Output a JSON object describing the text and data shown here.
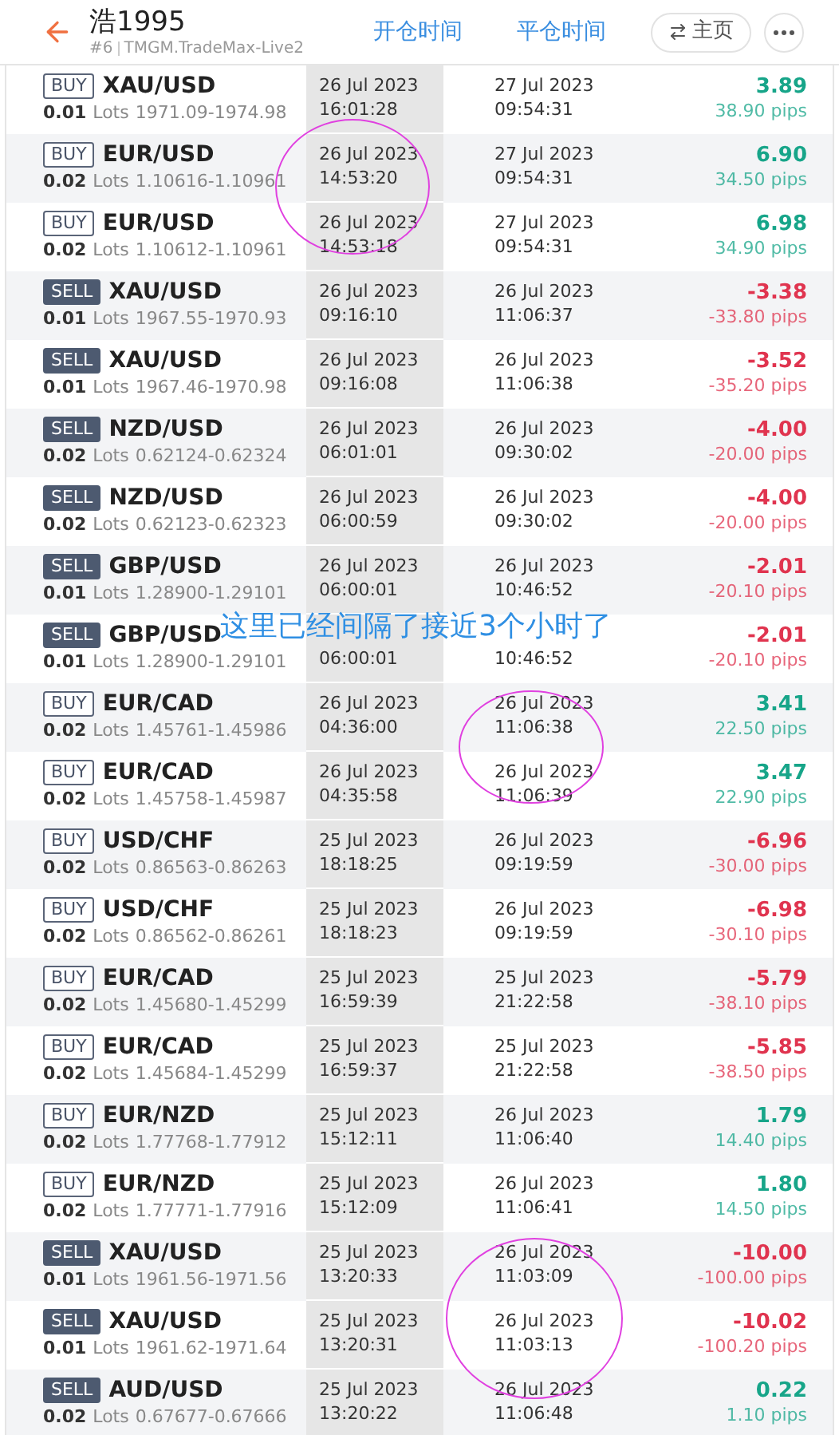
{
  "header": {
    "title": "浩1995",
    "account_number": "#6",
    "server": "TMGM.TradeMax-Live2",
    "column_headers": [
      "开仓时间",
      "平仓时间"
    ],
    "home_button": "主页"
  },
  "trades": [
    {
      "kind": "buy",
      "side": "BUY",
      "pair": "XAU/USD",
      "lots": "0.01",
      "lots_label": "Lots",
      "range": "1971.09-1974.98",
      "open_date": "26 Jul 2023",
      "open_time": "16:01:28",
      "close_date": "27 Jul 2023",
      "close_time": "09:54:31",
      "color": "#17a589",
      "profit": "3.89",
      "pips": "38.90 pips"
    },
    {
      "kind": "buy",
      "side": "BUY",
      "pair": "EUR/USD",
      "lots": "0.02",
      "lots_label": "Lots",
      "range": "1.10616-1.10961",
      "open_date": "26 Jul 2023",
      "open_time": "14:53:20",
      "close_date": "27 Jul 2023",
      "close_time": "09:54:31",
      "color": "#17a589",
      "profit": "6.90",
      "pips": "34.50 pips"
    },
    {
      "kind": "buy",
      "side": "BUY",
      "pair": "EUR/USD",
      "lots": "0.02",
      "lots_label": "Lots",
      "range": "1.10612-1.10961",
      "open_date": "26 Jul 2023",
      "open_time": "14:53:18",
      "close_date": "27 Jul 2023",
      "close_time": "09:54:31",
      "color": "#17a589",
      "profit": "6.98",
      "pips": "34.90 pips"
    },
    {
      "kind": "sell",
      "side": "SELL",
      "pair": "XAU/USD",
      "lots": "0.01",
      "lots_label": "Lots",
      "range": "1967.55-1970.93",
      "open_date": "26 Jul 2023",
      "open_time": "09:16:10",
      "close_date": "26 Jul 2023",
      "close_time": "11:06:37",
      "color": "#e0344f",
      "profit": "-3.38",
      "pips": "-33.80 pips"
    },
    {
      "kind": "sell",
      "side": "SELL",
      "pair": "XAU/USD",
      "lots": "0.01",
      "lots_label": "Lots",
      "range": "1967.46-1970.98",
      "open_date": "26 Jul 2023",
      "open_time": "09:16:08",
      "close_date": "26 Jul 2023",
      "close_time": "11:06:38",
      "color": "#e0344f",
      "profit": "-3.52",
      "pips": "-35.20 pips"
    },
    {
      "kind": "sell",
      "side": "SELL",
      "pair": "NZD/USD",
      "lots": "0.02",
      "lots_label": "Lots",
      "range": "0.62124-0.62324",
      "open_date": "26 Jul 2023",
      "open_time": "06:01:01",
      "close_date": "26 Jul 2023",
      "close_time": "09:30:02",
      "color": "#e0344f",
      "profit": "-4.00",
      "pips": "-20.00 pips"
    },
    {
      "kind": "sell",
      "side": "SELL",
      "pair": "NZD/USD",
      "lots": "0.02",
      "lots_label": "Lots",
      "range": "0.62123-0.62323",
      "open_date": "26 Jul 2023",
      "open_time": "06:00:59",
      "close_date": "26 Jul 2023",
      "close_time": "09:30:02",
      "color": "#e0344f",
      "profit": "-4.00",
      "pips": "-20.00 pips"
    },
    {
      "kind": "sell",
      "side": "SELL",
      "pair": "GBP/USD",
      "lots": "0.01",
      "lots_label": "Lots",
      "range": "1.28900-1.29101",
      "open_date": "26 Jul 2023",
      "open_time": "06:00:01",
      "close_date": "26 Jul 2023",
      "close_time": "10:46:52",
      "color": "#e0344f",
      "profit": "-2.01",
      "pips": "-20.10 pips"
    },
    {
      "kind": "sell",
      "side": "SELL",
      "pair": "GBP/USD",
      "lots": "0.01",
      "lots_label": "Lots",
      "range": "1.28900-1.29101",
      "open_time": "06:00:01",
      "close_time": "10:46:52",
      "color": "#e0344f",
      "profit": "-2.01",
      "pips": "-20.10 pips"
    },
    {
      "kind": "buy",
      "side": "BUY",
      "pair": "EUR/CAD",
      "lots": "0.02",
      "lots_label": "Lots",
      "range": "1.45761-1.45986",
      "open_date": "26 Jul 2023",
      "open_time": "04:36:00",
      "close_date": "26 Jul 2023",
      "close_time": "11:06:38",
      "color": "#17a589",
      "profit": "3.41",
      "pips": "22.50 pips"
    },
    {
      "kind": "buy",
      "side": "BUY",
      "pair": "EUR/CAD",
      "lots": "0.02",
      "lots_label": "Lots",
      "range": "1.45758-1.45987",
      "open_date": "26 Jul 2023",
      "open_time": "04:35:58",
      "close_date": "26 Jul 2023",
      "close_time": "11:06:39",
      "color": "#17a589",
      "profit": "3.47",
      "pips": "22.90 pips"
    },
    {
      "kind": "buy",
      "side": "BUY",
      "pair": "USD/CHF",
      "lots": "0.02",
      "lots_label": "Lots",
      "range": "0.86563-0.86263",
      "open_date": "25 Jul 2023",
      "open_time": "18:18:25",
      "close_date": "26 Jul 2023",
      "close_time": "09:19:59",
      "color": "#e0344f",
      "profit": "-6.96",
      "pips": "-30.00 pips"
    },
    {
      "kind": "buy",
      "side": "BUY",
      "pair": "USD/CHF",
      "lots": "0.02",
      "lots_label": "Lots",
      "range": "0.86562-0.86261",
      "open_date": "25 Jul 2023",
      "open_time": "18:18:23",
      "close_date": "26 Jul 2023",
      "close_time": "09:19:59",
      "color": "#e0344f",
      "profit": "-6.98",
      "pips": "-30.10 pips"
    },
    {
      "kind": "buy",
      "side": "BUY",
      "pair": "EUR/CAD",
      "lots": "0.02",
      "lots_label": "Lots",
      "range": "1.45680-1.45299",
      "open_date": "25 Jul 2023",
      "open_time": "16:59:39",
      "close_date": "25 Jul 2023",
      "close_time": "21:22:58",
      "color": "#e0344f",
      "profit": "-5.79",
      "pips": "-38.10 pips"
    },
    {
      "kind": "buy",
      "side": "BUY",
      "pair": "EUR/CAD",
      "lots": "0.02",
      "lots_label": "Lots",
      "range": "1.45684-1.45299",
      "open_date": "25 Jul 2023",
      "open_time": "16:59:37",
      "close_date": "25 Jul 2023",
      "close_time": "21:22:58",
      "color": "#e0344f",
      "profit": "-5.85",
      "pips": "-38.50 pips"
    },
    {
      "kind": "buy",
      "side": "BUY",
      "pair": "EUR/NZD",
      "lots": "0.02",
      "lots_label": "Lots",
      "range": "1.77768-1.77912",
      "open_date": "25 Jul 2023",
      "open_time": "15:12:11",
      "close_date": "26 Jul 2023",
      "close_time": "11:06:40",
      "color": "#17a589",
      "profit": "1.79",
      "pips": "14.40 pips"
    },
    {
      "kind": "buy",
      "side": "BUY",
      "pair": "EUR/NZD",
      "lots": "0.02",
      "lots_label": "Lots",
      "range": "1.77771-1.77916",
      "open_date": "25 Jul 2023",
      "open_time": "15:12:09",
      "close_date": "26 Jul 2023",
      "close_time": "11:06:41",
      "color": "#17a589",
      "profit": "1.80",
      "pips": "14.50 pips"
    },
    {
      "kind": "sell",
      "side": "SELL",
      "pair": "XAU/USD",
      "lots": "0.01",
      "lots_label": "Lots",
      "range": "1961.56-1971.56",
      "open_date": "25 Jul 2023",
      "open_time": "13:20:33",
      "close_date": "26 Jul 2023",
      "close_time": "11:03:09",
      "color": "#e0344f",
      "profit": "-10.00",
      "pips": "-100.00 pips"
    },
    {
      "kind": "sell",
      "side": "SELL",
      "pair": "XAU/USD",
      "lots": "0.01",
      "lots_label": "Lots",
      "range": "1961.62-1971.64",
      "open_date": "25 Jul 2023",
      "open_time": "13:20:31",
      "close_date": "26 Jul 2023",
      "close_time": "11:03:13",
      "color": "#e0344f",
      "profit": "-10.02",
      "pips": "-100.20 pips"
    },
    {
      "kind": "sell",
      "side": "SELL",
      "pair": "AUD/USD",
      "lots": "0.02",
      "lots_label": "Lots",
      "range": "0.67677-0.67666",
      "open_date": "25 Jul 2023",
      "open_time": "13:20:22",
      "close_date": "26 Jul 2023",
      "close_time": "11:06:48",
      "color": "#17a589",
      "profit": "0.22",
      "pips": "1.10 pips"
    }
  ],
  "annotation": {
    "note": "这里已经间隔了接近3个小时了"
  }
}
